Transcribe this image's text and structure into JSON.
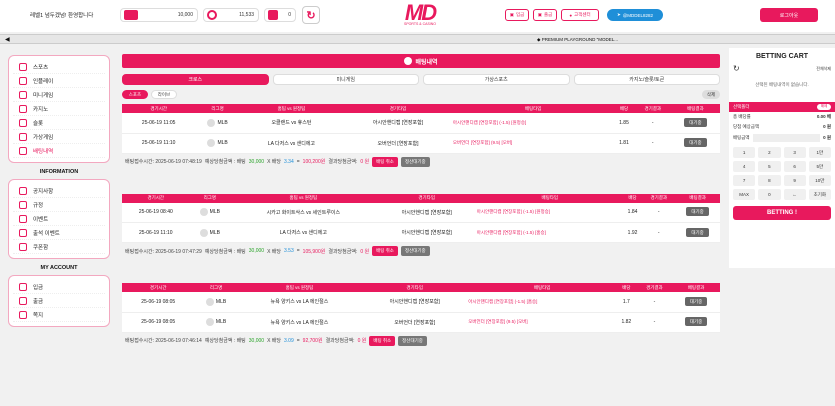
{
  "header": {
    "welcome": "레벨1 넘두겠넘! 환영합니다",
    "balance": "10,000",
    "points": "11,533",
    "messages": "0",
    "logo_mark": "MD",
    "logo_sub": "SPORTS & CASINO",
    "btn_charge": "입금",
    "btn_withdraw": "출금",
    "btn_support": "고객센터",
    "btn_telegram": "@MDDEL8282",
    "btn_login": "로그아웃"
  },
  "marquee": {
    "text": "◆ PREMIUM PLAYGROUND \"MODEL..."
  },
  "sidebar": {
    "menu": [
      "스포츠",
      "인플레이",
      "미니게임",
      "카지노",
      "슬롯",
      "가상게임",
      "배팅내역"
    ],
    "info_title": "INFORMATION",
    "info": [
      "공지사항",
      "규정",
      "이벤트",
      "출석 이벤트",
      "쿠폰함"
    ],
    "account_title": "MY ACCOUNT",
    "account": [
      "입금",
      "출금",
      "쪽지"
    ]
  },
  "main": {
    "banner": "배팅내역",
    "tabs": [
      "크로스",
      "미니게임",
      "가상스포츠",
      "카지노/슬롯/토큰"
    ],
    "subtabs": [
      "스포츠",
      "라이브"
    ],
    "delete": "삭제",
    "columns": [
      "경기시간",
      "리그명",
      "홈팀 vs 원정팀",
      "경기타입",
      "배팅타입",
      "배당",
      "경기결과",
      "배팅결과"
    ],
    "bets": [
      {
        "rows": [
          [
            "25-06-19 11:05",
            "MLB",
            "오클랜드 vs 휴스턴",
            "아시안핸디캡 [연장포함]",
            "아시안핸디캡 [연장포함] (-1.5) [원정승]",
            "1.85",
            "-",
            "대기중"
          ],
          [
            "25-06-19 11:10",
            "MLB",
            "LA 다저스 vs 샌디에고",
            "오버언더 [연장포함]",
            "오버언더 [연장포함] (9.5) [오버]",
            "1.81",
            "-",
            "대기중"
          ]
        ],
        "summary": {
          "label": "배팅접수시간: 2025-06-19 07:48:19",
          "expected": "예상당첨금액 : 배팅",
          "stake": "30,000",
          "x": "X 배당",
          "odds": "3.34",
          "eq": "=",
          "payout": "100,200원",
          "result": "결과당첨금액:",
          "result_val": "0 원",
          "cancel": "배팅 취소",
          "settle": "정산대기중"
        }
      },
      {
        "rows": [
          [
            "25-06-19 08:40",
            "MLB",
            "시카고 화이트삭스 vs 세인트루이스",
            "아시안핸디캡 [연장포함]",
            "아시안핸디캡 [연장포함] (-1.5) [원정승]",
            "1.84",
            "-",
            "대기중"
          ],
          [
            "25-06-19 11:10",
            "MLB",
            "LA 다저스 vs 샌디에고",
            "아시안핸디캡 [연장포함]",
            "아시안핸디캡 [연장포함] (-1.5) [홈승]",
            "1.92",
            "-",
            "대기중"
          ]
        ],
        "summary": {
          "label": "배팅접수시간: 2025-06-19 07:47:29",
          "expected": "예상당첨금액 : 배팅",
          "stake": "30,000",
          "x": "X 배당",
          "odds": "3.53",
          "eq": "=",
          "payout": "105,900원",
          "result": "결과당첨금액:",
          "result_val": "0 원",
          "cancel": "배팅 취소",
          "settle": "정산대기중"
        }
      },
      {
        "rows": [
          [
            "25-06-19 08:05",
            "MLB",
            "뉴욕 양키스 vs LA 에인절스",
            "아시안핸디캡 [연장포함]",
            "아시안핸디캡 [연장포함] (-1.5) [홈승]",
            "1.7",
            "-",
            "대기중"
          ],
          [
            "25-06-19 08:05",
            "MLB",
            "뉴욕 양키스 vs LA 에인절스",
            "오버언더 [연장포함]",
            "오버언더 [연장포함] (9.5) [오버]",
            "1.82",
            "-",
            "대기중"
          ]
        ],
        "summary": {
          "label": "배팅접수시간: 2025-06-19 07:46:14",
          "expected": "예상당첨금액 : 배팅",
          "stake": "30,000",
          "x": "X 배당",
          "odds": "3.09",
          "eq": "=",
          "payout": "92,700원",
          "result": "결과당첨금액:",
          "result_val": "0 원",
          "cancel": "배팅 취소",
          "settle": "정산대기중"
        }
      }
    ]
  },
  "cart": {
    "title": "BETTING CART",
    "clear": "전체삭제",
    "empty": "선택된 배팅내역이 없습니다.",
    "selected_label": "선택폴더",
    "toggle": "해제",
    "total_odds_label": "총 배당률",
    "total_odds": "0.00 배",
    "expected_label": "당첨 예상금액",
    "expected": "0 원",
    "amount_label": "배팅금액",
    "amount": "0 원",
    "keys": [
      "1",
      "2",
      "3",
      "1만",
      "4",
      "5",
      "6",
      "5만",
      "7",
      "8",
      "9",
      "10만",
      "MAX",
      "0",
      "←",
      "초기화"
    ],
    "bet_button": "BETTING !"
  },
  "colors": {
    "accent": "#e8195d",
    "telegram": "#1f8fd8"
  }
}
